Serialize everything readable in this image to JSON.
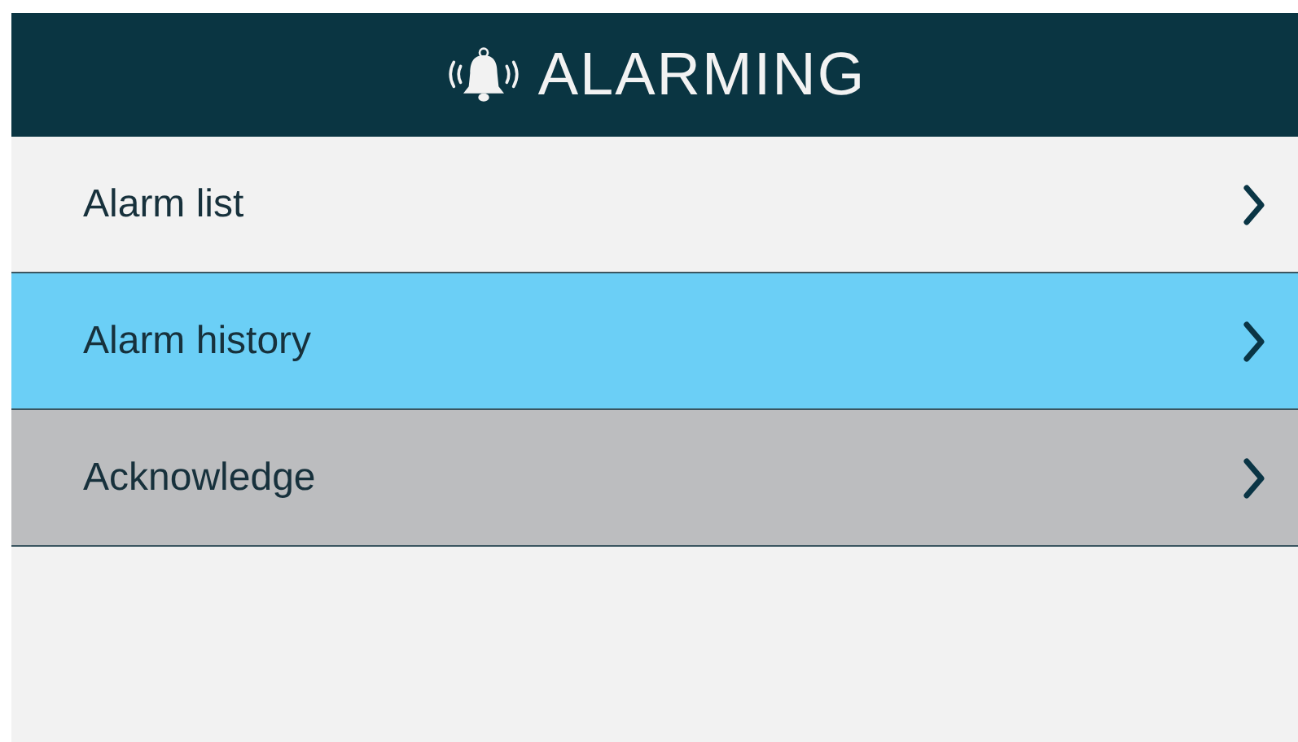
{
  "header": {
    "title": "ALARMING"
  },
  "menu_items": [
    {
      "label": "Alarm list",
      "selected": false,
      "pressed": false
    },
    {
      "label": "Alarm history",
      "selected": true,
      "pressed": false
    },
    {
      "label": "Acknowledge",
      "selected": false,
      "pressed": true
    }
  ]
}
